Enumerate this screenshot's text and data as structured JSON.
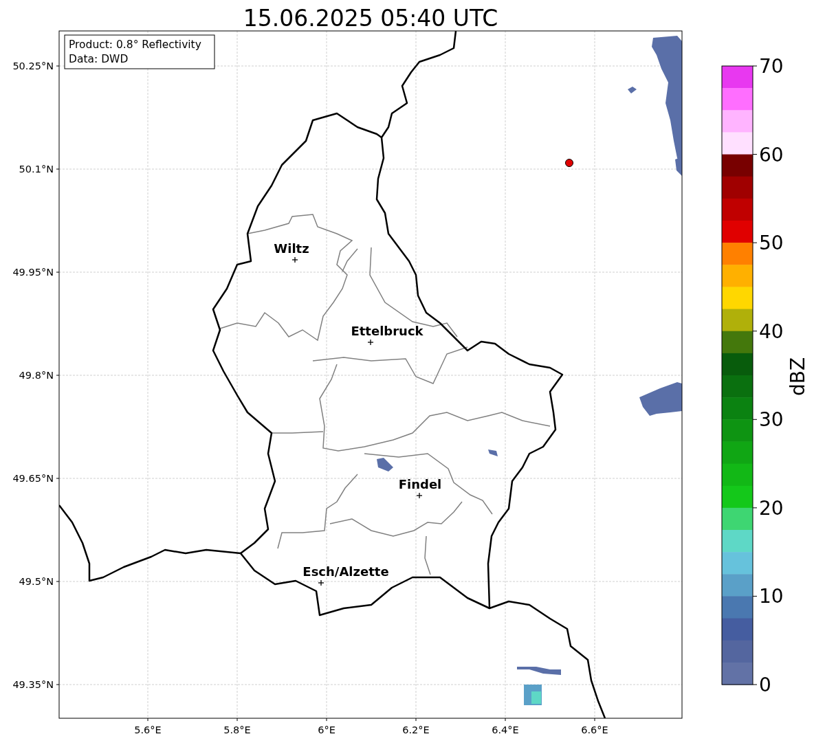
{
  "title": "15.06.2025 05:40 UTC",
  "info_box": [
    "Product: 0.8° Reflectivity",
    "Data: DWD"
  ],
  "map": {
    "y_ticks": [
      "50.25°N",
      "50.1°N",
      "49.95°N",
      "49.8°N",
      "49.65°N",
      "49.5°N",
      "49.35°N"
    ],
    "x_ticks": [
      "5.6°E",
      "5.8°E",
      "6°E",
      "6.2°E",
      "6.4°E",
      "6.6°E"
    ],
    "cities": [
      {
        "name": "Wiltz"
      },
      {
        "name": "Ettelbruck"
      },
      {
        "name": "Findel"
      },
      {
        "name": "Esch/Alzette"
      }
    ]
  },
  "colorbar": {
    "label": "dBZ",
    "ticks": [
      "70",
      "60",
      "50",
      "40",
      "30",
      "20",
      "10",
      "0"
    ],
    "bins": [
      {
        "color": "#e838f0"
      },
      {
        "color": "#ff6eff"
      },
      {
        "color": "#ffb4ff"
      },
      {
        "color": "#ffe0ff"
      },
      {
        "color": "#780000"
      },
      {
        "color": "#a00000"
      },
      {
        "color": "#c00000"
      },
      {
        "color": "#e00000"
      },
      {
        "color": "#ff8000"
      },
      {
        "color": "#ffb000"
      },
      {
        "color": "#ffd700"
      },
      {
        "color": "#b0b00a"
      },
      {
        "color": "#44780c"
      },
      {
        "color": "#085c0c"
      },
      {
        "color": "#0a700f"
      },
      {
        "color": "#0b8211"
      },
      {
        "color": "#0e9412"
      },
      {
        "color": "#10a614"
      },
      {
        "color": "#12b816"
      },
      {
        "color": "#14c81a"
      },
      {
        "color": "#3ed672"
      },
      {
        "color": "#5ed8c6"
      },
      {
        "color": "#66c2dc"
      },
      {
        "color": "#5aa0c8"
      },
      {
        "color": "#4a78b0"
      },
      {
        "color": "#455da0"
      },
      {
        "color": "#54669f"
      },
      {
        "color": "#6272a6"
      }
    ]
  }
}
